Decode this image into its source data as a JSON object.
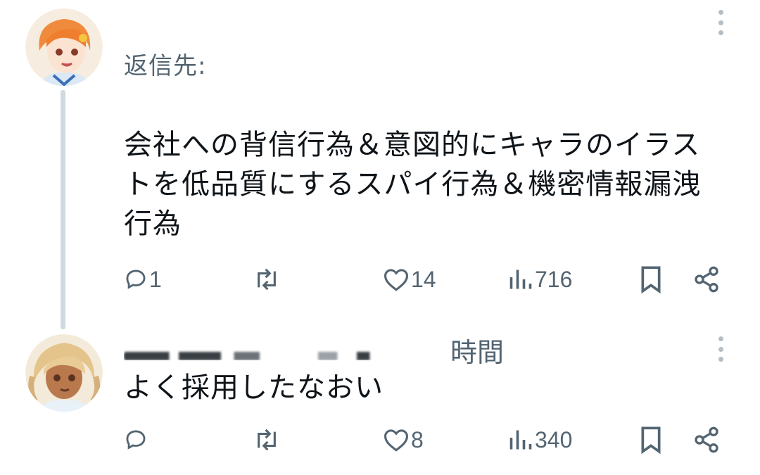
{
  "thread": [
    {
      "reply_to_label": "返信先:",
      "text": "会社への背信行為＆意図的にキャラのイラストを低品質にするスパイ行為＆機密情報漏洩行為",
      "stats": {
        "replies": "1",
        "retweets": "",
        "likes": "14",
        "views": "716"
      }
    },
    {
      "time": "時間",
      "text": "よく採用したなおい",
      "stats": {
        "replies": "",
        "retweets": "",
        "likes": "8",
        "views": "340"
      }
    }
  ],
  "icons": {
    "avatar1": "anime-girl-orange-hair-avatar",
    "avatar2": "anime-girl-blonde-hair-avatar",
    "more": "more-vertical-icon",
    "reply": "reply-icon",
    "retweet": "retweet-icon",
    "like": "heart-icon",
    "views": "views-icon",
    "bookmark": "bookmark-icon",
    "share": "share-icon"
  },
  "colors": {
    "text": "#0f1419",
    "secondary": "#536471",
    "thread_line": "#cfd9de"
  }
}
